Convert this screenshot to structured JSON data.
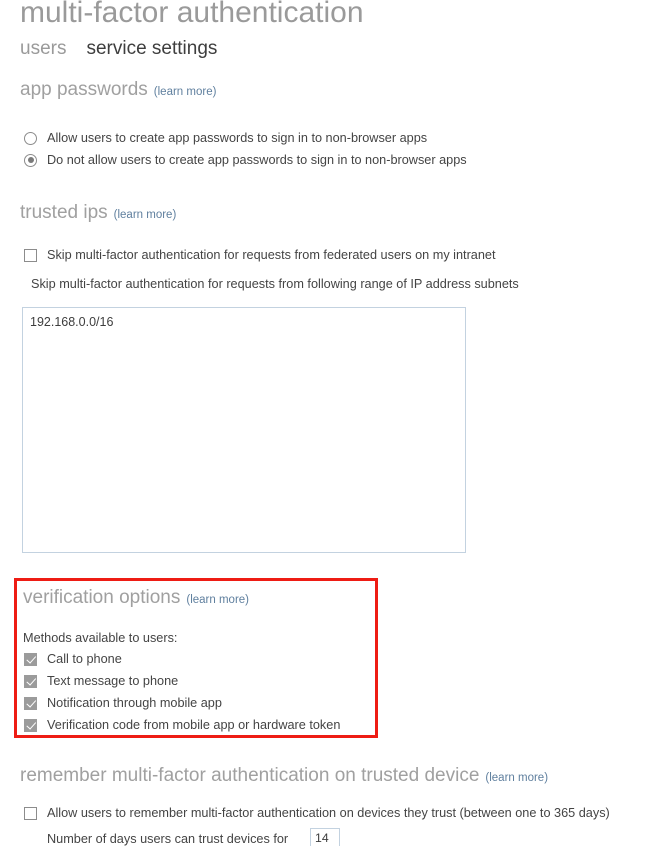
{
  "header": {
    "title": "multi-factor authentication",
    "tabs": [
      {
        "label": "users",
        "active": false
      },
      {
        "label": "service settings",
        "active": true
      }
    ]
  },
  "learn_more_label": "(learn more)",
  "sections": {
    "app_passwords": {
      "heading": "app passwords",
      "learn_more": "(learn more)",
      "options": [
        {
          "label": "Allow users to create app passwords to sign in to non-browser apps",
          "selected": false
        },
        {
          "label": "Do not allow users to create app passwords to sign in to non-browser apps",
          "selected": true
        }
      ]
    },
    "trusted_ips": {
      "heading": "trusted ips",
      "learn_more": "(learn more)",
      "federated_checkbox": {
        "label": "Skip multi-factor authentication for requests from federated users on my intranet",
        "checked": false
      },
      "subnet_label": "Skip multi-factor authentication for requests from following range of IP address subnets",
      "subnet_value": "192.168.0.0/16",
      "subnet_placeholder": ""
    },
    "verification_options": {
      "heading": "verification options",
      "learn_more": "(learn more)",
      "methods_label": "Methods available to users:",
      "methods": [
        {
          "label": "Call to phone",
          "checked": true
        },
        {
          "label": "Text message to phone",
          "checked": true
        },
        {
          "label": "Notification through mobile app",
          "checked": true
        },
        {
          "label": "Verification code from mobile app or hardware token",
          "checked": true
        }
      ],
      "highlight_color": "#ee1c14"
    },
    "remember_mfa": {
      "heading": "remember multi-factor authentication on trusted device",
      "learn_more": "(learn more)",
      "allow_checkbox": {
        "label": "Allow users to remember multi-factor authentication on devices they trust (between one to 365 days)",
        "checked": false
      },
      "days_label": "Number of days users can trust devices for",
      "days_value": "14"
    }
  },
  "colors": {
    "heading": "#a0a0a0",
    "link": "#5f7f9e",
    "text": "#444444",
    "checkbox_fill": "#9b9b9b",
    "input_border": "#c3d2e0",
    "highlight": "#ee1c14"
  }
}
